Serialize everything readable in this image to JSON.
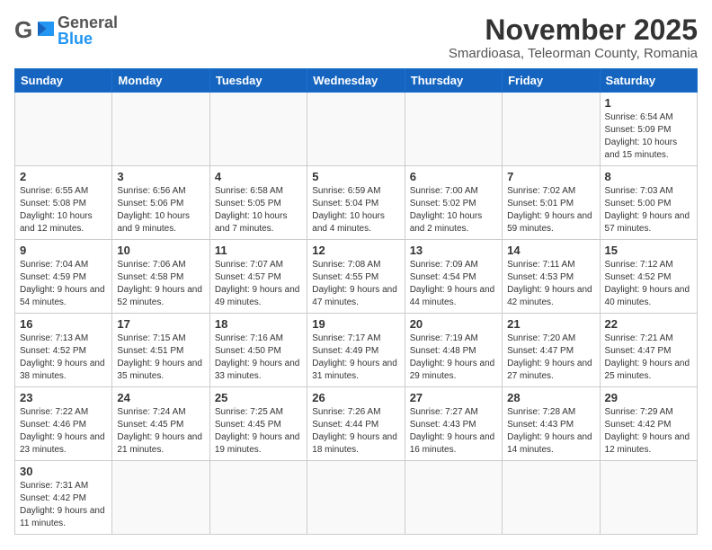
{
  "logo": {
    "general": "General",
    "blue": "Blue"
  },
  "header": {
    "month": "November 2025",
    "location": "Smardioasa, Teleorman County, Romania"
  },
  "days_of_week": [
    "Sunday",
    "Monday",
    "Tuesday",
    "Wednesday",
    "Thursday",
    "Friday",
    "Saturday"
  ],
  "weeks": [
    [
      {
        "day": "",
        "info": ""
      },
      {
        "day": "",
        "info": ""
      },
      {
        "day": "",
        "info": ""
      },
      {
        "day": "",
        "info": ""
      },
      {
        "day": "",
        "info": ""
      },
      {
        "day": "",
        "info": ""
      },
      {
        "day": "1",
        "info": "Sunrise: 6:54 AM\nSunset: 5:09 PM\nDaylight: 10 hours and 15 minutes."
      }
    ],
    [
      {
        "day": "2",
        "info": "Sunrise: 6:55 AM\nSunset: 5:08 PM\nDaylight: 10 hours and 12 minutes."
      },
      {
        "day": "3",
        "info": "Sunrise: 6:56 AM\nSunset: 5:06 PM\nDaylight: 10 hours and 9 minutes."
      },
      {
        "day": "4",
        "info": "Sunrise: 6:58 AM\nSunset: 5:05 PM\nDaylight: 10 hours and 7 minutes."
      },
      {
        "day": "5",
        "info": "Sunrise: 6:59 AM\nSunset: 5:04 PM\nDaylight: 10 hours and 4 minutes."
      },
      {
        "day": "6",
        "info": "Sunrise: 7:00 AM\nSunset: 5:02 PM\nDaylight: 10 hours and 2 minutes."
      },
      {
        "day": "7",
        "info": "Sunrise: 7:02 AM\nSunset: 5:01 PM\nDaylight: 9 hours and 59 minutes."
      },
      {
        "day": "8",
        "info": "Sunrise: 7:03 AM\nSunset: 5:00 PM\nDaylight: 9 hours and 57 minutes."
      }
    ],
    [
      {
        "day": "9",
        "info": "Sunrise: 7:04 AM\nSunset: 4:59 PM\nDaylight: 9 hours and 54 minutes."
      },
      {
        "day": "10",
        "info": "Sunrise: 7:06 AM\nSunset: 4:58 PM\nDaylight: 9 hours and 52 minutes."
      },
      {
        "day": "11",
        "info": "Sunrise: 7:07 AM\nSunset: 4:57 PM\nDaylight: 9 hours and 49 minutes."
      },
      {
        "day": "12",
        "info": "Sunrise: 7:08 AM\nSunset: 4:55 PM\nDaylight: 9 hours and 47 minutes."
      },
      {
        "day": "13",
        "info": "Sunrise: 7:09 AM\nSunset: 4:54 PM\nDaylight: 9 hours and 44 minutes."
      },
      {
        "day": "14",
        "info": "Sunrise: 7:11 AM\nSunset: 4:53 PM\nDaylight: 9 hours and 42 minutes."
      },
      {
        "day": "15",
        "info": "Sunrise: 7:12 AM\nSunset: 4:52 PM\nDaylight: 9 hours and 40 minutes."
      }
    ],
    [
      {
        "day": "16",
        "info": "Sunrise: 7:13 AM\nSunset: 4:52 PM\nDaylight: 9 hours and 38 minutes."
      },
      {
        "day": "17",
        "info": "Sunrise: 7:15 AM\nSunset: 4:51 PM\nDaylight: 9 hours and 35 minutes."
      },
      {
        "day": "18",
        "info": "Sunrise: 7:16 AM\nSunset: 4:50 PM\nDaylight: 9 hours and 33 minutes."
      },
      {
        "day": "19",
        "info": "Sunrise: 7:17 AM\nSunset: 4:49 PM\nDaylight: 9 hours and 31 minutes."
      },
      {
        "day": "20",
        "info": "Sunrise: 7:19 AM\nSunset: 4:48 PM\nDaylight: 9 hours and 29 minutes."
      },
      {
        "day": "21",
        "info": "Sunrise: 7:20 AM\nSunset: 4:47 PM\nDaylight: 9 hours and 27 minutes."
      },
      {
        "day": "22",
        "info": "Sunrise: 7:21 AM\nSunset: 4:47 PM\nDaylight: 9 hours and 25 minutes."
      }
    ],
    [
      {
        "day": "23",
        "info": "Sunrise: 7:22 AM\nSunset: 4:46 PM\nDaylight: 9 hours and 23 minutes."
      },
      {
        "day": "24",
        "info": "Sunrise: 7:24 AM\nSunset: 4:45 PM\nDaylight: 9 hours and 21 minutes."
      },
      {
        "day": "25",
        "info": "Sunrise: 7:25 AM\nSunset: 4:45 PM\nDaylight: 9 hours and 19 minutes."
      },
      {
        "day": "26",
        "info": "Sunrise: 7:26 AM\nSunset: 4:44 PM\nDaylight: 9 hours and 18 minutes."
      },
      {
        "day": "27",
        "info": "Sunrise: 7:27 AM\nSunset: 4:43 PM\nDaylight: 9 hours and 16 minutes."
      },
      {
        "day": "28",
        "info": "Sunrise: 7:28 AM\nSunset: 4:43 PM\nDaylight: 9 hours and 14 minutes."
      },
      {
        "day": "29",
        "info": "Sunrise: 7:29 AM\nSunset: 4:42 PM\nDaylight: 9 hours and 12 minutes."
      }
    ],
    [
      {
        "day": "30",
        "info": "Sunrise: 7:31 AM\nSunset: 4:42 PM\nDaylight: 9 hours and 11 minutes."
      },
      {
        "day": "",
        "info": ""
      },
      {
        "day": "",
        "info": ""
      },
      {
        "day": "",
        "info": ""
      },
      {
        "day": "",
        "info": ""
      },
      {
        "day": "",
        "info": ""
      },
      {
        "day": "",
        "info": ""
      }
    ]
  ]
}
